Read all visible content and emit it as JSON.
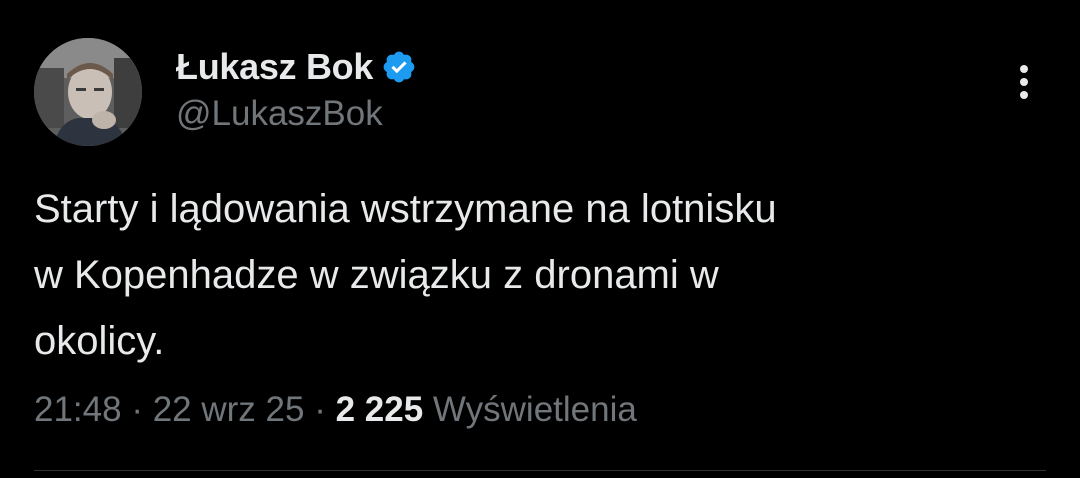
{
  "tweet": {
    "author": {
      "display_name": "Łukasz Bok",
      "handle": "@LukaszBok",
      "verified": true,
      "avatar_icon": "avatar-photo"
    },
    "text_lines": [
      "Starty i lądowania wstrzymane na lotnisku",
      "w Kopenhadze w związku z dronami w",
      "okolicy."
    ],
    "time": "21:48",
    "date": "22 wrz 25",
    "separator": "·",
    "views_count": "2 225",
    "views_label": "Wyświetlenia",
    "more_icon": "more-vertical-icon"
  },
  "colors": {
    "background": "#000000",
    "primary_text": "#e7e9ea",
    "secondary_text": "#71767b",
    "verified_blue": "#1d9bf0",
    "divider": "#2f3336"
  }
}
